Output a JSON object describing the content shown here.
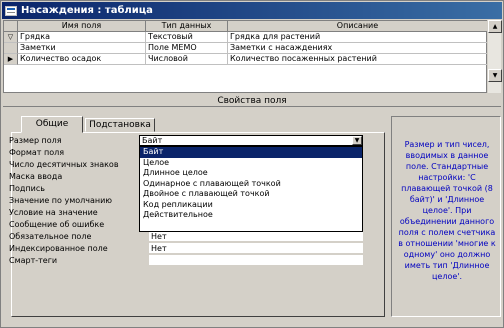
{
  "window": {
    "title": "Насаждения : таблица"
  },
  "grid": {
    "headers": [
      "Имя поля",
      "Тип данных",
      "Описание"
    ],
    "rows": [
      {
        "marker": "▽",
        "name": "Грядка",
        "type": "Текстовый",
        "desc": "Грядка для растений"
      },
      {
        "marker": "",
        "name": "Заметки",
        "type": "Поле MEMO",
        "desc": "Заметки с насаждениях"
      },
      {
        "marker": "▶",
        "name": "Количество осадок",
        "type": "Числовой",
        "desc": "Количество посаженных растений"
      }
    ]
  },
  "properties_header": "Свойства поля",
  "tabs": {
    "general": "Общие",
    "lookup": "Подстановка"
  },
  "props": {
    "labels": [
      "Размер поля",
      "Формат поля",
      "Число десятичных знаков",
      "Маска ввода",
      "Подпись",
      "Значение по умолчанию",
      "Условие на значение",
      "Сообщение об ошибке",
      "Обязательное поле",
      "Индексированное поле",
      "Смарт-теги"
    ],
    "required_value": "Нет",
    "indexed_value": "Нет"
  },
  "dropdown": {
    "current": "Байт",
    "options": [
      "Байт",
      "Целое",
      "Длинное целое",
      "Одинарное с плавающей точкой",
      "Двойное с плавающей точкой",
      "Код репликации",
      "Действительное"
    ],
    "selected_index": 0
  },
  "help_text": "Размер и тип чисел, вводимых в данное поле. Стандартные настройки: 'С плавающей точкой (8 байт)' и 'Длинное целое'. При объединении данного поля с полем счетчика в отношении 'многие к одному' оно должно иметь тип 'Длинное целое'."
}
